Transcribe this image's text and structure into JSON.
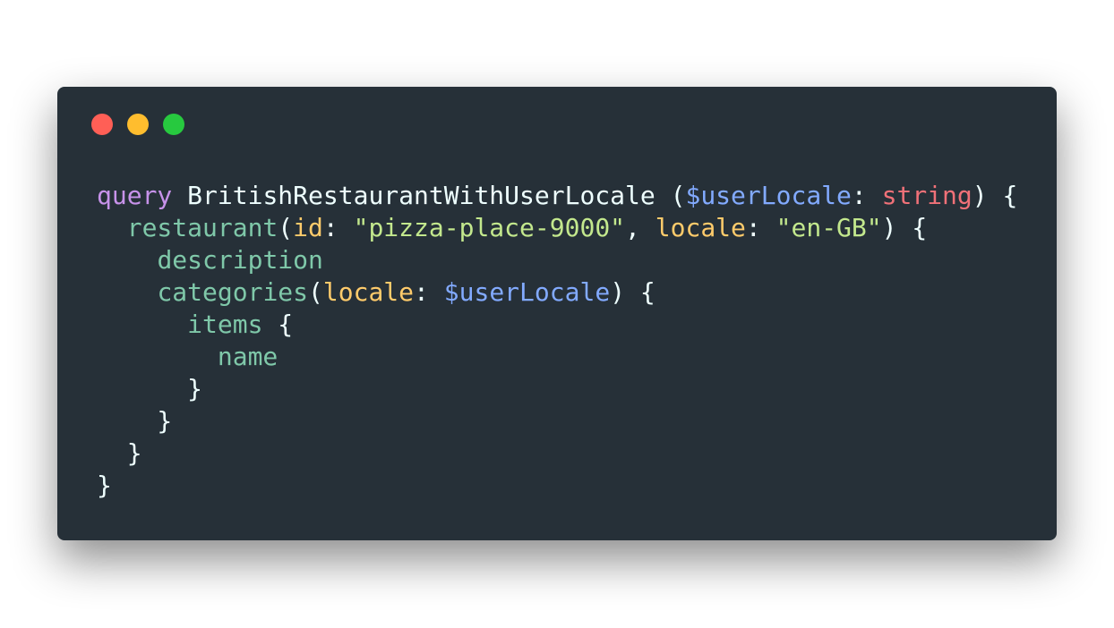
{
  "window": {
    "controls": [
      {
        "name": "close",
        "color": "#ff5f56"
      },
      {
        "name": "minimize",
        "color": "#ffbd2e"
      },
      {
        "name": "maximize",
        "color": "#27c93f"
      }
    ]
  },
  "code": {
    "language": "graphql",
    "lines": [
      [
        {
          "t": "keyword",
          "v": "query"
        },
        {
          "t": "punct",
          "v": " "
        },
        {
          "t": "name",
          "v": "BritishRestaurantWithUserLocale"
        },
        {
          "t": "punct",
          "v": " ("
        },
        {
          "t": "variable",
          "v": "$userLocale"
        },
        {
          "t": "punct",
          "v": ": "
        },
        {
          "t": "type",
          "v": "string"
        },
        {
          "t": "punct",
          "v": ") {"
        }
      ],
      [
        {
          "t": "punct",
          "v": "  "
        },
        {
          "t": "field",
          "v": "restaurant"
        },
        {
          "t": "punct",
          "v": "("
        },
        {
          "t": "arg",
          "v": "id"
        },
        {
          "t": "punct",
          "v": ": "
        },
        {
          "t": "string",
          "v": "\"pizza-place-9000\""
        },
        {
          "t": "punct",
          "v": ", "
        },
        {
          "t": "arg",
          "v": "locale"
        },
        {
          "t": "punct",
          "v": ": "
        },
        {
          "t": "string",
          "v": "\"en-GB\""
        },
        {
          "t": "punct",
          "v": ") {"
        }
      ],
      [
        {
          "t": "punct",
          "v": "    "
        },
        {
          "t": "field",
          "v": "description"
        }
      ],
      [
        {
          "t": "punct",
          "v": "    "
        },
        {
          "t": "field",
          "v": "categories"
        },
        {
          "t": "punct",
          "v": "("
        },
        {
          "t": "arg",
          "v": "locale"
        },
        {
          "t": "punct",
          "v": ": "
        },
        {
          "t": "variable",
          "v": "$userLocale"
        },
        {
          "t": "punct",
          "v": ") {"
        }
      ],
      [
        {
          "t": "punct",
          "v": "      "
        },
        {
          "t": "field",
          "v": "items"
        },
        {
          "t": "punct",
          "v": " {"
        }
      ],
      [
        {
          "t": "punct",
          "v": "        "
        },
        {
          "t": "field",
          "v": "name"
        }
      ],
      [
        {
          "t": "punct",
          "v": "      }"
        }
      ],
      [
        {
          "t": "punct",
          "v": "    }"
        }
      ],
      [
        {
          "t": "punct",
          "v": "  }"
        }
      ],
      [
        {
          "t": "punct",
          "v": "}"
        }
      ]
    ]
  }
}
